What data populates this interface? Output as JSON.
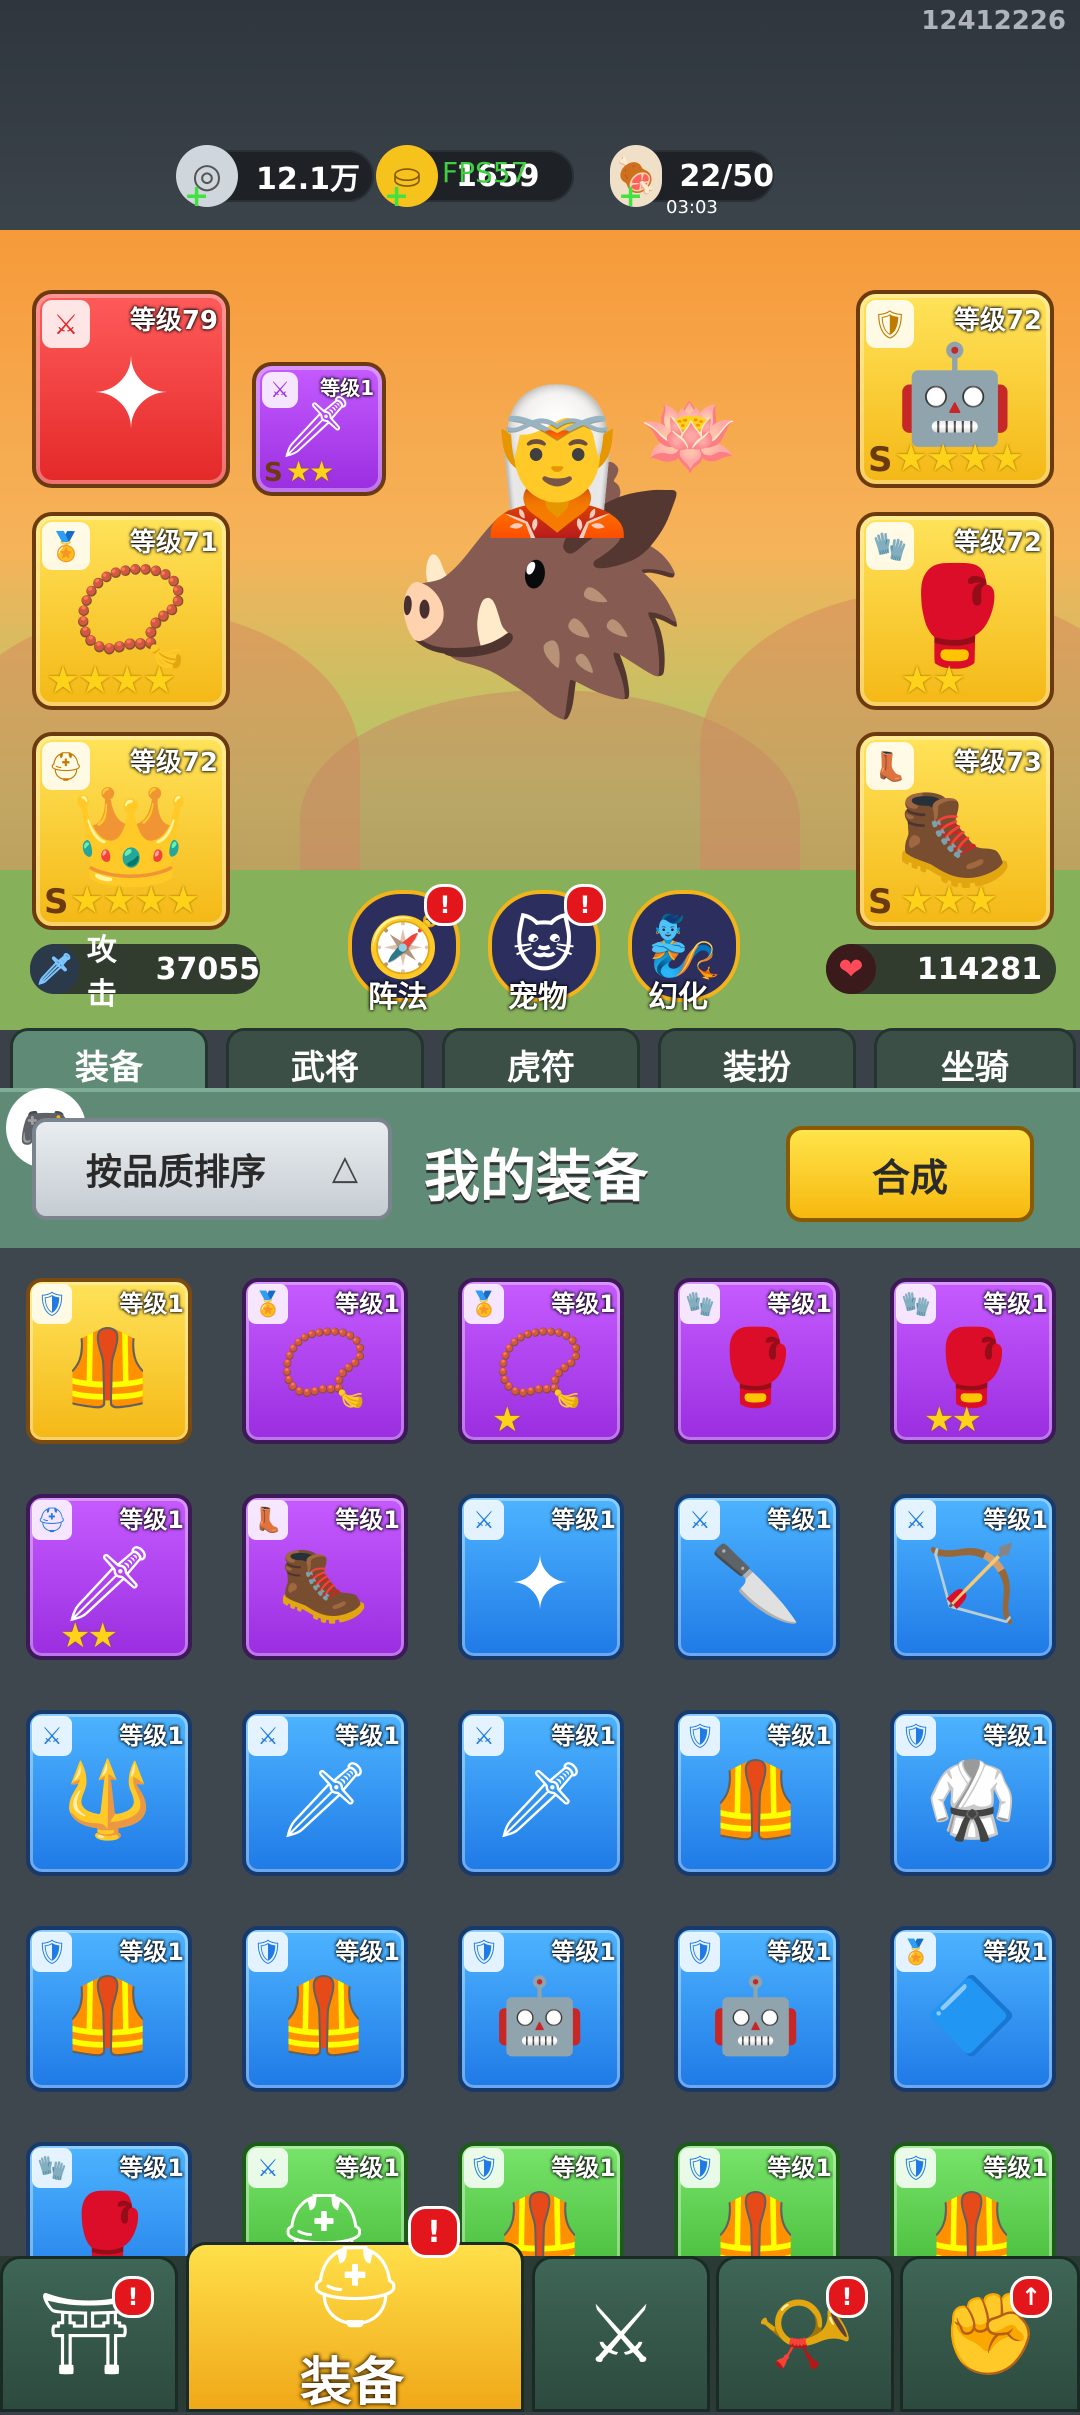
{
  "account_id": "12412226",
  "resources": [
    {
      "name": "silver",
      "icon": "silver-coin-icon",
      "value": "12.1万",
      "sub": ""
    },
    {
      "name": "gold",
      "icon": "gold-ingot-icon",
      "value": "1659",
      "sub": ""
    },
    {
      "name": "stamina",
      "icon": "meat-icon",
      "value": "22/50",
      "sub": "03:03"
    }
  ],
  "overlay_text": "FPS57",
  "hero_slots": {
    "weapon": {
      "level": "等级79",
      "quality": "red",
      "type_icon": "sword-icon",
      "item_icon": "shuriken-icon"
    },
    "accessory": {
      "level": "等级1",
      "quality": "purple",
      "type_icon": "sword-icon",
      "item_icon": "ice-dagger-icon",
      "stars": 2,
      "rank": "S"
    },
    "medal": {
      "level": "等级71",
      "quality": "gold",
      "type_icon": "medal-icon",
      "item_icon": "amulet-icon",
      "stars": 4
    },
    "helmet": {
      "level": "等级72",
      "quality": "gold",
      "type_icon": "helmet-icon",
      "item_icon": "crown-helmet-icon",
      "stars": 4,
      "rank": "S"
    },
    "armor": {
      "level": "等级72",
      "quality": "gold",
      "type_icon": "armor-icon",
      "item_icon": "mech-armor-icon",
      "stars": 4,
      "rank": "S"
    },
    "bracer": {
      "level": "等级72",
      "quality": "gold",
      "type_icon": "bracer-icon",
      "item_icon": "bracer-item-icon",
      "stars": 2
    },
    "boots": {
      "level": "等级73",
      "quality": "gold",
      "type_icon": "boot-icon",
      "item_icon": "boots-item-icon",
      "stars": 3,
      "rank": "S"
    }
  },
  "feature_buttons": [
    {
      "label": "阵法",
      "icon": "formation-icon",
      "alert": "!"
    },
    {
      "label": "宠物",
      "icon": "pet-cat-icon",
      "alert": "!"
    },
    {
      "label": "幻化",
      "icon": "transform-icon",
      "alert": ""
    }
  ],
  "stats": {
    "attack_label": "攻击",
    "attack_value": "37055",
    "hp_value": "114281"
  },
  "tabs": [
    {
      "label": "装备",
      "active": true,
      "alert": ""
    },
    {
      "label": "武将",
      "active": false,
      "alert": "!"
    },
    {
      "label": "虎符",
      "active": false,
      "alert": ""
    },
    {
      "label": "装扮",
      "active": false,
      "alert": ""
    },
    {
      "label": "坐骑",
      "active": false,
      "alert": "!"
    }
  ],
  "sort_button": "按品质排序",
  "sort_arrow": "△",
  "panel_title": "我的装备",
  "synth_button": "合成",
  "inventory": [
    {
      "q": "gold",
      "t": "armor-icon",
      "i": "bronze-armor-icon",
      "lv": "等级1",
      "s": 0
    },
    {
      "q": "purple",
      "t": "medal-icon",
      "i": "jade-pendant-icon",
      "lv": "等级1",
      "s": 0
    },
    {
      "q": "purple",
      "t": "medal-icon",
      "i": "amulet-icon",
      "lv": "等级1",
      "s": 1
    },
    {
      "q": "purple",
      "t": "bracer-icon",
      "i": "bracer-item-icon",
      "lv": "等级1",
      "s": 0
    },
    {
      "q": "purple",
      "t": "bracer-icon",
      "i": "bracer-item-icon",
      "lv": "等级1",
      "s": 2
    },
    {
      "q": "purple",
      "t": "helmet-icon",
      "i": "sword-item-icon",
      "lv": "等级1",
      "s": 2
    },
    {
      "q": "purple",
      "t": "boot-icon",
      "i": "boots-item-icon",
      "lv": "等级1",
      "s": 0
    },
    {
      "q": "blue",
      "t": "sword-icon",
      "i": "shuriken-icon",
      "lv": "等级1",
      "s": 0
    },
    {
      "q": "blue",
      "t": "sword-icon",
      "i": "scimitar-icon",
      "lv": "等级1",
      "s": 0
    },
    {
      "q": "blue",
      "t": "sword-icon",
      "i": "crossbow-icon",
      "lv": "等级1",
      "s": 0
    },
    {
      "q": "blue",
      "t": "sword-icon",
      "i": "dragon-gun-icon",
      "lv": "等级1",
      "s": 0
    },
    {
      "q": "blue",
      "t": "sword-icon",
      "i": "glaive-icon",
      "lv": "等级1",
      "s": 0
    },
    {
      "q": "blue",
      "t": "sword-icon",
      "i": "glaive-icon",
      "lv": "等级1",
      "s": 0
    },
    {
      "q": "blue",
      "t": "armor-icon",
      "i": "bronze-armor-icon",
      "lv": "等级1",
      "s": 0
    },
    {
      "q": "blue",
      "t": "armor-icon",
      "i": "robe-icon",
      "lv": "等级1",
      "s": 0
    },
    {
      "q": "blue",
      "t": "armor-icon",
      "i": "red-armor-icon",
      "lv": "等级1",
      "s": 0
    },
    {
      "q": "blue",
      "t": "armor-icon",
      "i": "red-armor-icon",
      "lv": "等级1",
      "s": 0
    },
    {
      "q": "blue",
      "t": "armor-icon",
      "i": "mech-armor-icon",
      "lv": "等级1",
      "s": 0
    },
    {
      "q": "blue",
      "t": "armor-icon",
      "i": "mech-armor-icon",
      "lv": "等级1",
      "s": 0
    },
    {
      "q": "blue",
      "t": "medal-icon",
      "i": "pendant-icon",
      "lv": "等级1",
      "s": 0
    },
    {
      "q": "blue",
      "t": "bracer-icon",
      "i": "bracer-item-icon",
      "lv": "等级1",
      "s": 0
    },
    {
      "q": "green",
      "t": "sword-icon",
      "i": "helmet-item-icon",
      "lv": "等级1",
      "s": 0
    },
    {
      "q": "green",
      "t": "armor-icon",
      "i": "bronze-armor-icon",
      "lv": "等级1",
      "s": 0
    },
    {
      "q": "green",
      "t": "armor-icon",
      "i": "red-armor-icon",
      "lv": "等级1",
      "s": 0
    },
    {
      "q": "green",
      "t": "armor-icon",
      "i": "bronze-armor-icon",
      "lv": "等级1",
      "s": 0
    }
  ],
  "bottom_nav": [
    {
      "name": "gate",
      "icon": "gate-icon",
      "label": "",
      "alert": "!"
    },
    {
      "name": "equipment",
      "icon": "helmet-icon",
      "label": "装备",
      "alert": "!",
      "active": true
    },
    {
      "name": "battle",
      "icon": "crossed-swords-icon",
      "label": "",
      "alert": ""
    },
    {
      "name": "horn",
      "icon": "horn-icon",
      "label": "",
      "alert": "!"
    },
    {
      "name": "upgrade",
      "icon": "fist-icon",
      "label": "",
      "alert": "↑"
    }
  ],
  "colors": {
    "gold": "#f4b816",
    "purple": "#9a2ee0",
    "blue": "#1f7ae6",
    "green": "#3fb532",
    "red": "#e42828",
    "panel": "#5f8b76"
  }
}
